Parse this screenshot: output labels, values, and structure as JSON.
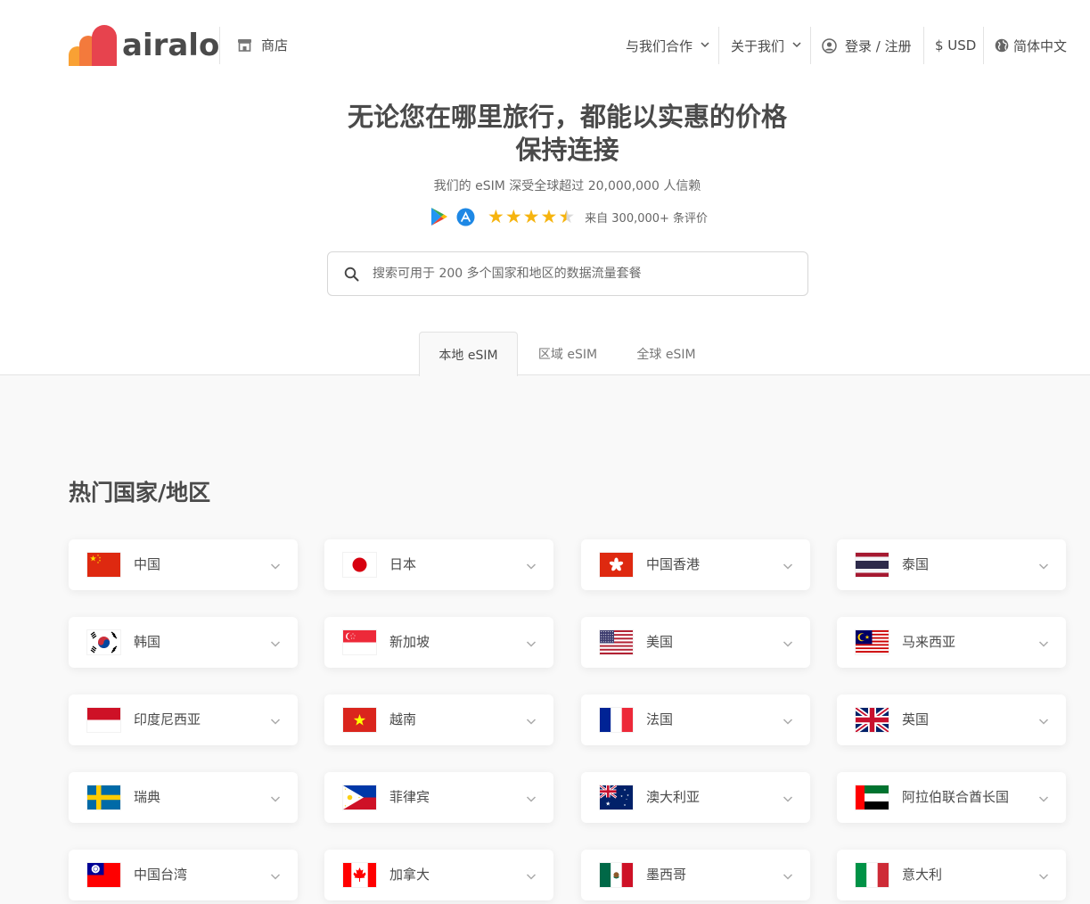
{
  "header": {
    "logo_text": "airalo",
    "store": "商店",
    "nav": {
      "partner": "与我们合作",
      "about": "关于我们",
      "login": "登录 / 注册",
      "currency": "$ USD",
      "language": "简体中文"
    }
  },
  "hero": {
    "title_line1": "无论您在哪里旅行，都能以实惠的价格",
    "title_line2": "保持连接",
    "subtitle": "我们的 eSIM 深受全球超过 20,000,000 人信赖",
    "rating": 4.5,
    "reviews": "来自 300,000+ 条评价"
  },
  "search": {
    "placeholder": "搜索可用于 200 多个国家和地区的数据流量套餐",
    "value": ""
  },
  "tabs": [
    {
      "label": "本地 eSIM",
      "active": true
    },
    {
      "label": "区域 eSIM",
      "active": false
    },
    {
      "label": "全球 eSIM",
      "active": false
    }
  ],
  "section": {
    "title": "热门国家/地区"
  },
  "countries": [
    {
      "name": "中国",
      "flag": "cn"
    },
    {
      "name": "日本",
      "flag": "jp"
    },
    {
      "name": "中国香港",
      "flag": "hk"
    },
    {
      "name": "泰国",
      "flag": "th"
    },
    {
      "name": "韩国",
      "flag": "kr"
    },
    {
      "name": "新加坡",
      "flag": "sg"
    },
    {
      "name": "美国",
      "flag": "us"
    },
    {
      "name": "马来西亚",
      "flag": "my"
    },
    {
      "name": "印度尼西亚",
      "flag": "id"
    },
    {
      "name": "越南",
      "flag": "vn"
    },
    {
      "name": "法国",
      "flag": "fr"
    },
    {
      "name": "英国",
      "flag": "gb"
    },
    {
      "name": "瑞典",
      "flag": "se"
    },
    {
      "name": "菲律宾",
      "flag": "ph"
    },
    {
      "name": "澳大利亚",
      "flag": "au"
    },
    {
      "name": "阿拉伯联合酋长国",
      "flag": "ae"
    },
    {
      "name": "中国台湾",
      "flag": "tw"
    },
    {
      "name": "加拿大",
      "flag": "ca"
    },
    {
      "name": "墨西哥",
      "flag": "mx"
    },
    {
      "name": "意大利",
      "flag": "it"
    }
  ],
  "colors": {
    "brand_red": "#e7434e",
    "brand_orange": "#f37a3c",
    "brand_yellow": "#f9a134",
    "star": "#f6b40f"
  }
}
